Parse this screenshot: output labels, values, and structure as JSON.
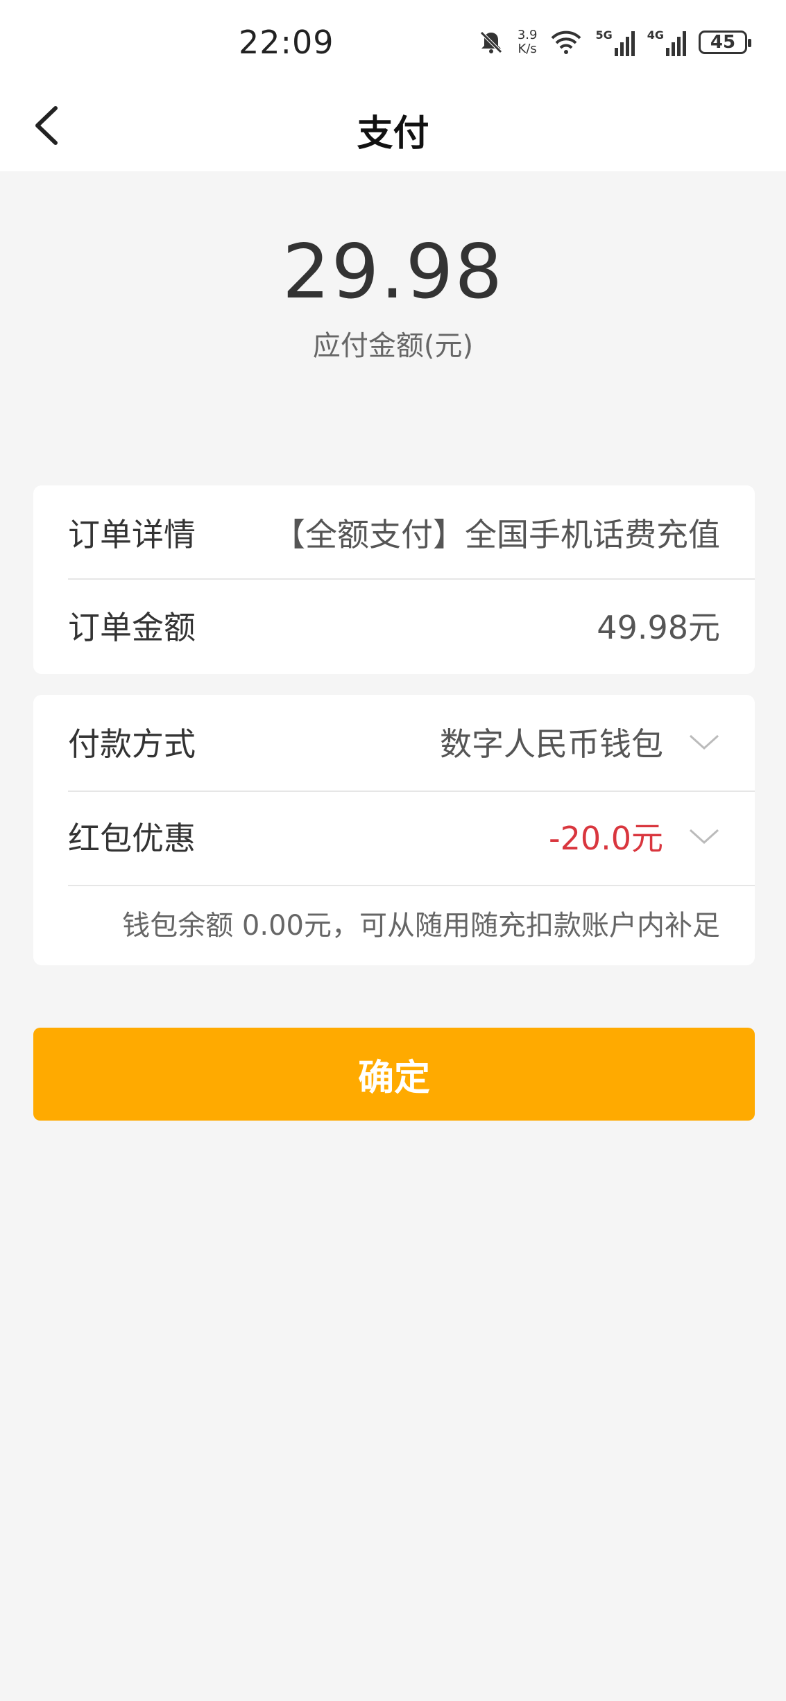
{
  "status_bar": {
    "time": "22:09",
    "net_speed_top": "3.9",
    "net_speed_bottom": "K/s",
    "sig1": "5G",
    "sig2": "4G",
    "battery": "45"
  },
  "header": {
    "title": "支付"
  },
  "payment": {
    "amount": "29.98",
    "amount_label": "应付金额(元)"
  },
  "order": {
    "detail_label": "订单详情",
    "detail_value": "【全额支付】全国手机话费充值",
    "amount_label": "订单金额",
    "amount_value": "49.98元"
  },
  "pay": {
    "method_label": "付款方式",
    "method_value": "数字人民币钱包",
    "coupon_label": "红包优惠",
    "coupon_value": "-20.0元",
    "wallet_note": "钱包余额  0.00元，可从随用随充扣款账户内补足"
  },
  "actions": {
    "confirm": "确定"
  },
  "colors": {
    "accent": "#ffaa00",
    "discount": "#d9363e",
    "background": "#f5f5f5"
  }
}
